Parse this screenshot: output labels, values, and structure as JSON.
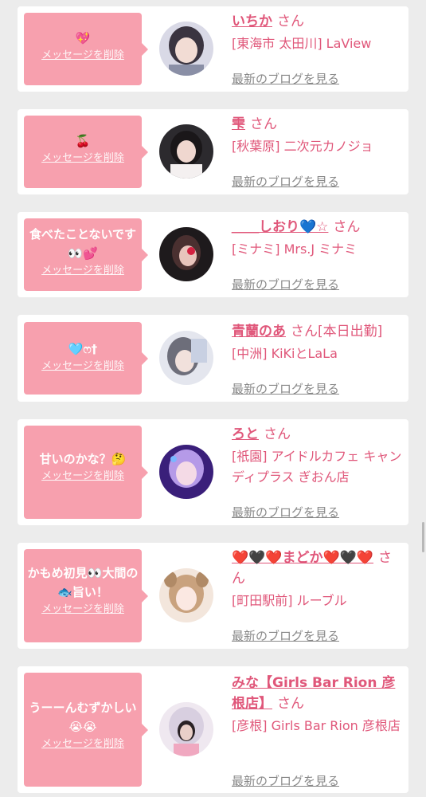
{
  "ui": {
    "delete_label": "メッセージを削除",
    "blog_label": "最新のブログを見る",
    "honorific": "さん"
  },
  "colors": {
    "bubble": "#f7a0ae",
    "name": "#e0577a",
    "link": "#888888",
    "background": "#ececec"
  },
  "items": [
    {
      "message": "💖",
      "name": "いちか",
      "extra": "",
      "shop": "[東海市 太田川] LaView"
    },
    {
      "message": "🍒",
      "name": "雫",
      "extra": "",
      "shop": "[秋葉原] 二次元カノジョ"
    },
    {
      "message": "食べたことないです👀💕",
      "name": "＿＿しおり💙☆",
      "extra": "",
      "shop": "[ミナミ] Mrs.J ミナミ"
    },
    {
      "message": "🩵ෆ†",
      "name": "青蘭のあ",
      "extra": "[本日出勤]",
      "shop": "[中洲] KiKiとLaLa"
    },
    {
      "message": "甘いのかな？🤔",
      "name": "ろと",
      "extra": "",
      "shop": "[祇園] アイドルカフェ キャンディプラス ぎおん店"
    },
    {
      "message": "かもめ初見👀大間の🐟旨い！",
      "name": "❤️🖤❤️まどか❤️🖤❤️",
      "extra": "",
      "shop": "[町田駅前] ルーブル"
    },
    {
      "message": "うーーんむずかしい😭😭",
      "name": "みな【Girls Bar Rion 彦根店】",
      "extra": "",
      "shop": "[彦根] Girls Bar Rion 彦根店"
    }
  ]
}
